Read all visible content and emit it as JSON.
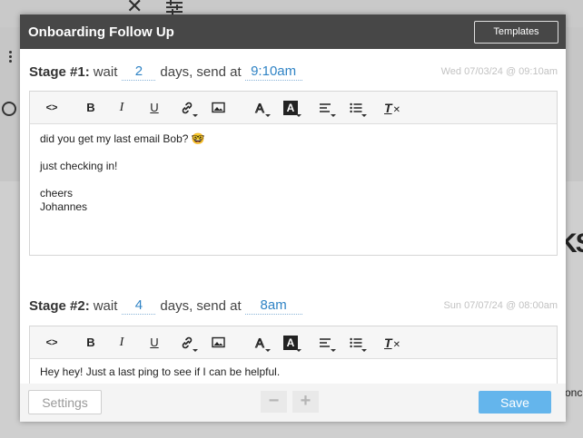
{
  "background": {
    "close_glyph": "✕",
    "right_text": "KS",
    "right_snippet": "onc"
  },
  "modal": {
    "title": "Onboarding Follow Up",
    "templates_label": "Templates"
  },
  "stage_words": {
    "wait": "wait",
    "days_send_at": "days, send at"
  },
  "toolbar": {
    "icons": [
      "code-icon",
      "bold-icon",
      "italic-icon",
      "underline-icon",
      "link-icon",
      "image-icon",
      "text-color-icon",
      "background-color-icon",
      "align-icon",
      "list-icon",
      "clear-format-icon"
    ],
    "code": "<>",
    "bold": "B",
    "italic": "I",
    "underline": "U",
    "text_color": "A",
    "bg_color": "A",
    "clear": "T"
  },
  "stages": [
    {
      "label": "Stage #1:",
      "wait_days": "2",
      "send_time": "9:10am",
      "date": "Wed 07/03/24 @ 09:10am",
      "content": {
        "line1": "did you get my last email Bob? 🤓",
        "line2": "just checking in!",
        "line3": "cheers",
        "line4": "Johannes"
      }
    },
    {
      "label": "Stage #2:",
      "wait_days": "4",
      "send_time": "8am",
      "date": "Sun 07/07/24 @ 08:00am",
      "content": {
        "line1": "Hey hey! Just a last ping to see if I can be helpful."
      }
    }
  ],
  "footer": {
    "settings_label": "Settings",
    "minus": "−",
    "plus": "+",
    "save_label": "Save"
  },
  "colors": {
    "header_bg": "#474747",
    "accent_blue": "#2f83c5",
    "save_bg": "#64b5ec"
  }
}
